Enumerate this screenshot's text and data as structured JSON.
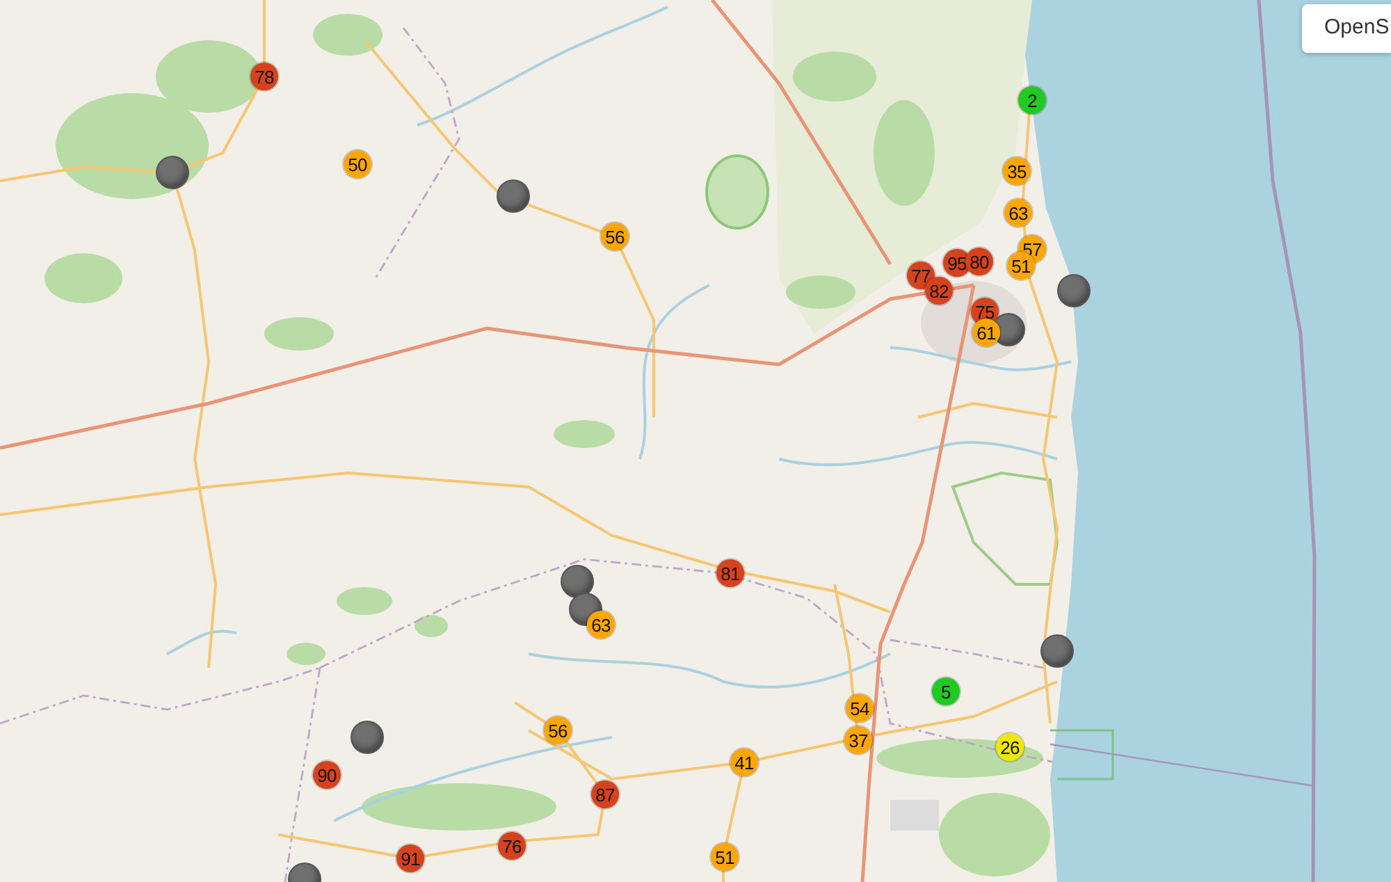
{
  "layer_control": {
    "label": "OpenS"
  },
  "markers": [
    {
      "value": "78",
      "color": "#d6421b"
    },
    {
      "value": "2",
      "color": "#22c922"
    },
    {
      "value": "50",
      "color": "#ffa600"
    },
    {
      "value": "35",
      "color": "#ffa600"
    },
    {
      "color": "#6f6f6f"
    },
    {
      "color": "#6f6f6f"
    },
    {
      "value": "63",
      "color": "#ffa600"
    },
    {
      "value": "56",
      "color": "#ffa600"
    },
    {
      "value": "57",
      "color": "#ffa600"
    },
    {
      "value": "95",
      "color": "#d6421b"
    },
    {
      "value": "80",
      "color": "#d6421b"
    },
    {
      "value": "51",
      "color": "#ffa600"
    },
    {
      "value": "77",
      "color": "#d6421b"
    },
    {
      "value": "82",
      "color": "#d6421b"
    },
    {
      "color": "#6f6f6f"
    },
    {
      "value": "75",
      "color": "#d6421b"
    },
    {
      "color": "#6f6f6f"
    },
    {
      "value": "61",
      "color": "#ffa600"
    },
    {
      "value": "81",
      "color": "#d6421b"
    },
    {
      "color": "#6f6f6f"
    },
    {
      "color": "#6f6f6f"
    },
    {
      "value": "63",
      "color": "#ffa600"
    },
    {
      "color": "#6f6f6f"
    },
    {
      "value": "5",
      "color": "#22c922"
    },
    {
      "value": "54",
      "color": "#ffa600"
    },
    {
      "value": "56",
      "color": "#ffa600"
    },
    {
      "color": "#6f6f6f"
    },
    {
      "value": "37",
      "color": "#ffa600"
    },
    {
      "value": "26",
      "color": "#eee800"
    },
    {
      "value": "41",
      "color": "#ffa600"
    },
    {
      "value": "90",
      "color": "#d6421b"
    },
    {
      "value": "87",
      "color": "#d6421b"
    },
    {
      "value": "76",
      "color": "#d6421b"
    },
    {
      "value": "51",
      "color": "#ffa600"
    },
    {
      "value": "91",
      "color": "#d6421b"
    },
    {
      "color": "#6f6f6f"
    }
  ]
}
